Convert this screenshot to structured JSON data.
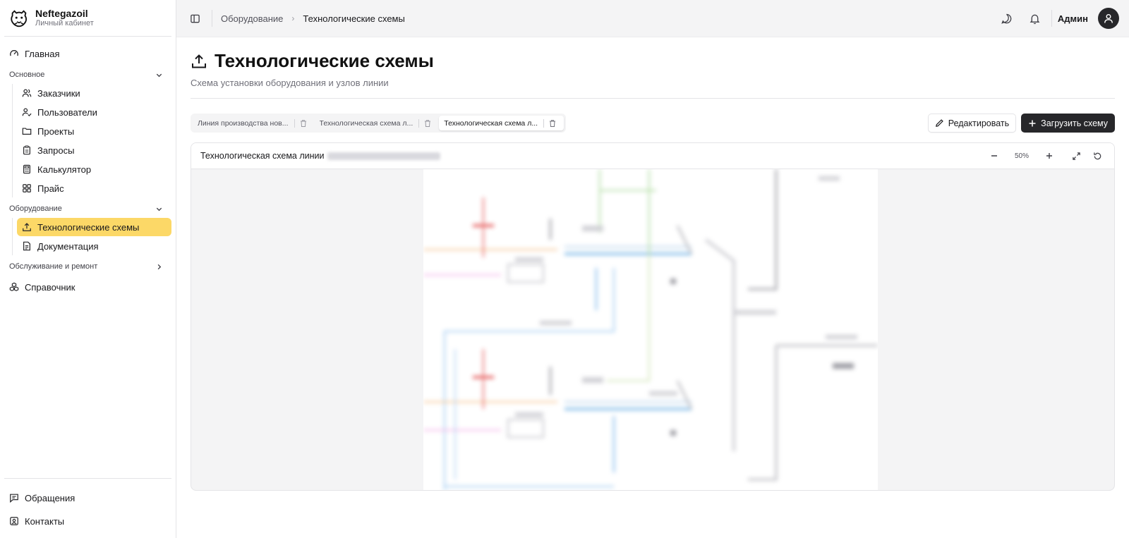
{
  "brand": {
    "name": "Neftegazoil",
    "subtitle": "Личный кабинет"
  },
  "nav": {
    "home": "Главная",
    "groups": [
      {
        "label": "Основное",
        "items": [
          "Заказчики",
          "Пользователи",
          "Проекты",
          "Запросы",
          "Калькулятор",
          "Прайс"
        ]
      },
      {
        "label": "Оборудование",
        "items": [
          "Технологические схемы",
          "Документация"
        ]
      },
      {
        "label": "Обслуживание и ремонт"
      }
    ],
    "reference": "Справочник",
    "bottom": [
      "Обращения",
      "Контакты"
    ]
  },
  "breadcrumb": {
    "parent": "Оборудование",
    "current": "Технологические схемы"
  },
  "user": {
    "name": "Админ"
  },
  "page": {
    "title": "Технологические схемы",
    "subtitle": "Схема установки оборудования и узлов линии"
  },
  "tabs": [
    {
      "label": "Линия производства нов...",
      "active": false
    },
    {
      "label": "Технологическая схема л...",
      "active": false
    },
    {
      "label": "Технологическая схема л...",
      "active": true
    }
  ],
  "actions": {
    "edit": "Редактировать",
    "upload": "Загрузить схему"
  },
  "viewer": {
    "title": "Технологическая схема линии",
    "zoom": "50%"
  },
  "colors": {
    "accent": "#fcd867",
    "dark_button": "#27272a"
  }
}
